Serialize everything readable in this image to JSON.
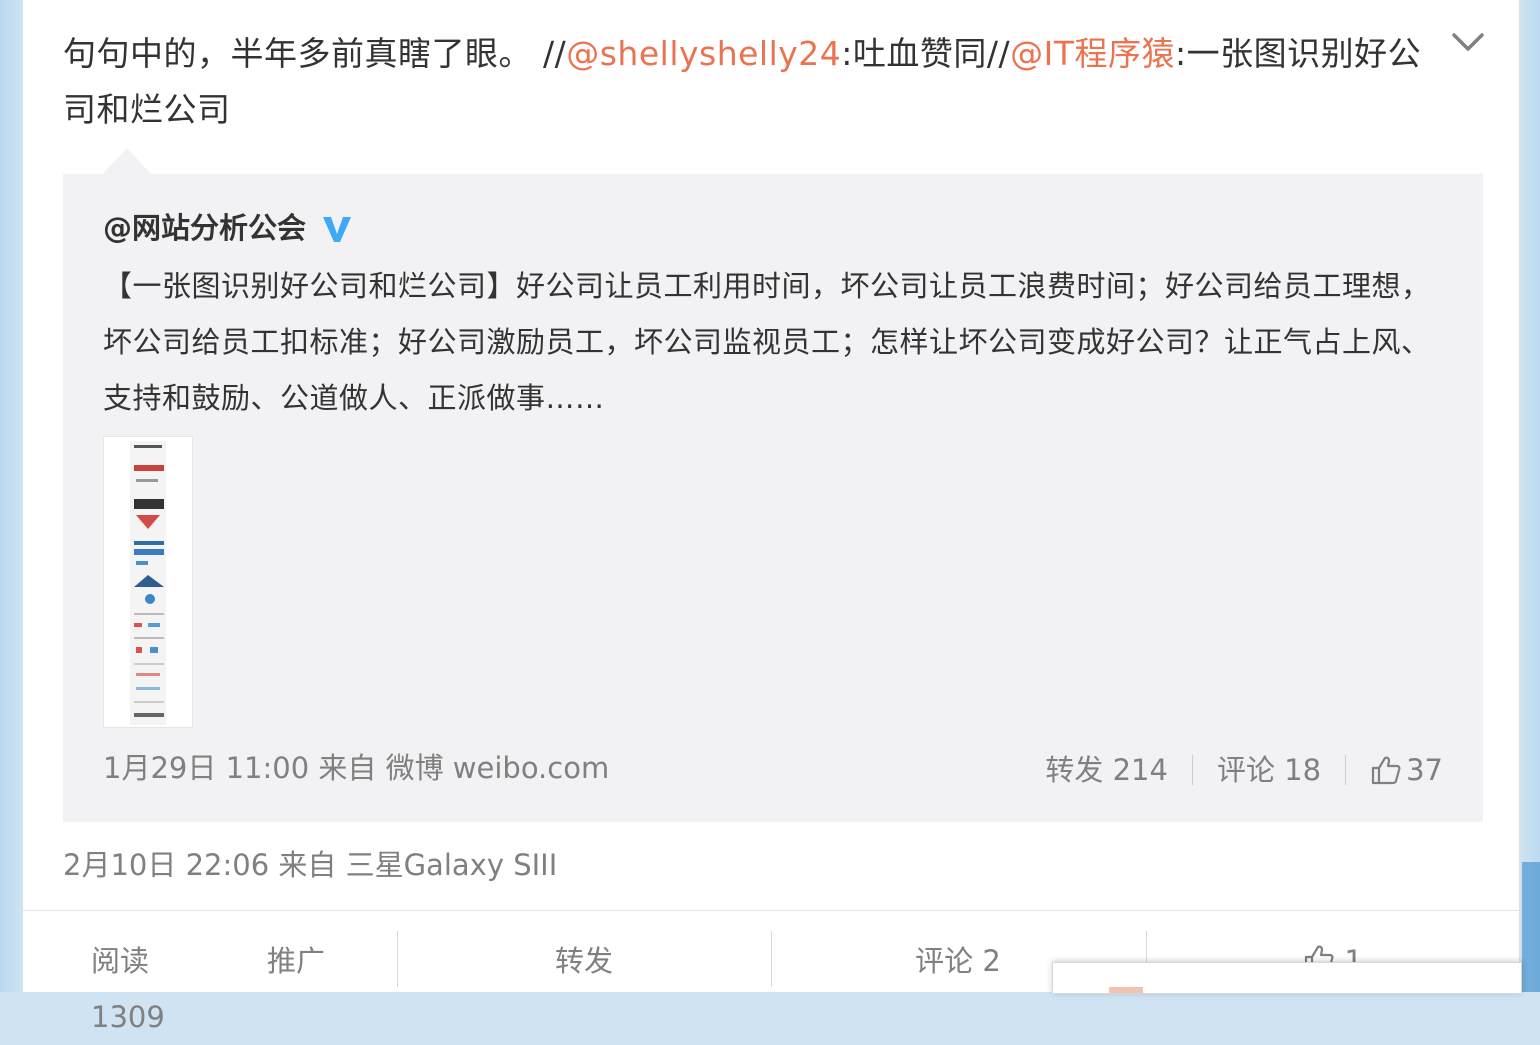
{
  "post": {
    "text_prefix": "句句中的，半年多前真瞎了眼。 //",
    "mention1": "@shellyshelly24",
    "text_mid": ":吐血赞同//",
    "mention2": "@IT程序猿",
    "text_suffix": ":一张图识别好公司和烂公司",
    "meta": "2月10日 22:06 来自 三星Galaxy SIII"
  },
  "quote": {
    "author": "@网站分析公会",
    "text": "【一张图识别好公司和烂公司】好公司让员工利用时间，坏公司让员工浪费时间；好公司给员工理想，坏公司给员工扣标准；好公司激励员工，坏公司监视员工；怎样让坏公司变成好公司？让正气占上风、支持和鼓励、公道做人、正派做事……",
    "meta": "1月29日 11:00 来自 微博 weibo.com",
    "repost_label": "转发 214",
    "comment_label": "评论 18",
    "like_count": "37"
  },
  "footer": {
    "reads": "阅读 1309",
    "promote": "推广",
    "repost": "转发",
    "comment": "评论 2",
    "like_count": "1"
  },
  "colors": {
    "mention": "#eb7350",
    "verified": "#3fa9f5",
    "text": "#333333",
    "muted": "#808080"
  },
  "icons": {
    "expand": "chevron-down-icon",
    "verified": "verified-v-icon",
    "like": "thumbs-up-icon"
  }
}
